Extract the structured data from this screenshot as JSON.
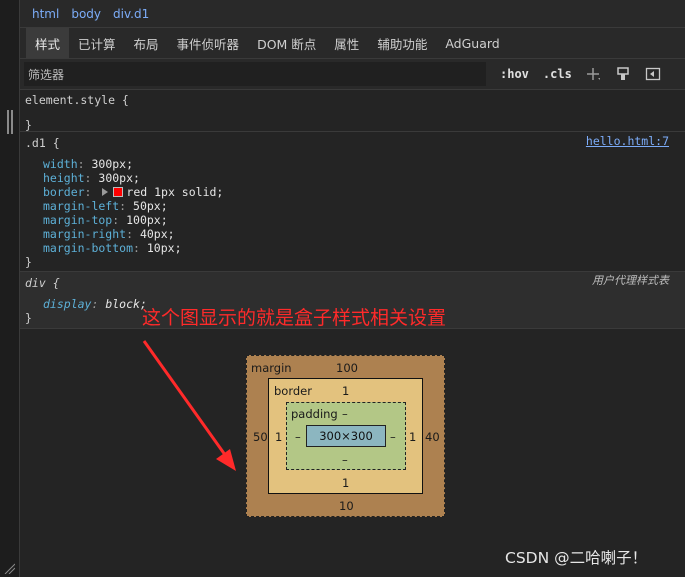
{
  "breadcrumb": [
    "html",
    "body",
    "div.d1"
  ],
  "tabs": [
    {
      "label": "样式",
      "active": true
    },
    {
      "label": "已计算"
    },
    {
      "label": "布局"
    },
    {
      "label": "事件侦听器"
    },
    {
      "label": "DOM 断点"
    },
    {
      "label": "属性"
    },
    {
      "label": "辅助功能"
    },
    {
      "label": "AdGuard"
    }
  ],
  "filter": {
    "placeholder": "筛选器",
    "hov": ":hov",
    "cls": ".cls"
  },
  "icons": [
    "new-rule-icon",
    "paint-brush-icon",
    "sidebar-toggle-icon"
  ],
  "rules": {
    "element_style": {
      "selector": "element.style {",
      "close": "}"
    },
    "d1": {
      "selector": ".d1 {",
      "source": "hello.html:7",
      "props": [
        {
          "name": "width",
          "value": "300px;"
        },
        {
          "name": "height",
          "value": "300px;"
        },
        {
          "name": "border",
          "value": "red 1px solid;"
        },
        {
          "name": "margin-left",
          "value": "50px;"
        },
        {
          "name": "margin-top",
          "value": "100px;"
        },
        {
          "name": "margin-right",
          "value": "40px;"
        },
        {
          "name": "margin-bottom",
          "value": "10px;"
        }
      ],
      "close": "}"
    },
    "div": {
      "selector": "div {",
      "source": "用户代理样式表",
      "props": [
        {
          "name": "display",
          "value": "block;"
        }
      ],
      "close": "}"
    }
  },
  "colors": {
    "border_swatch": "#ff0000",
    "annotation": "#ff2a2a"
  },
  "annotation": "这个图显示的就是盒子样式相关设置",
  "box_model": {
    "margin_label": "margin",
    "margin_top": "100",
    "margin_left": "50",
    "margin_right": "40",
    "margin_bottom": "10",
    "border_label": "border",
    "border_top": "1",
    "border_left": "1",
    "border_right": "1",
    "border_bottom": "1",
    "padding_label": "padding",
    "padding_top": "–",
    "padding_left": "–",
    "padding_right": "–",
    "padding_bottom": "–",
    "content": "300×300"
  },
  "watermark": "CSDN @二哈喇子！"
}
